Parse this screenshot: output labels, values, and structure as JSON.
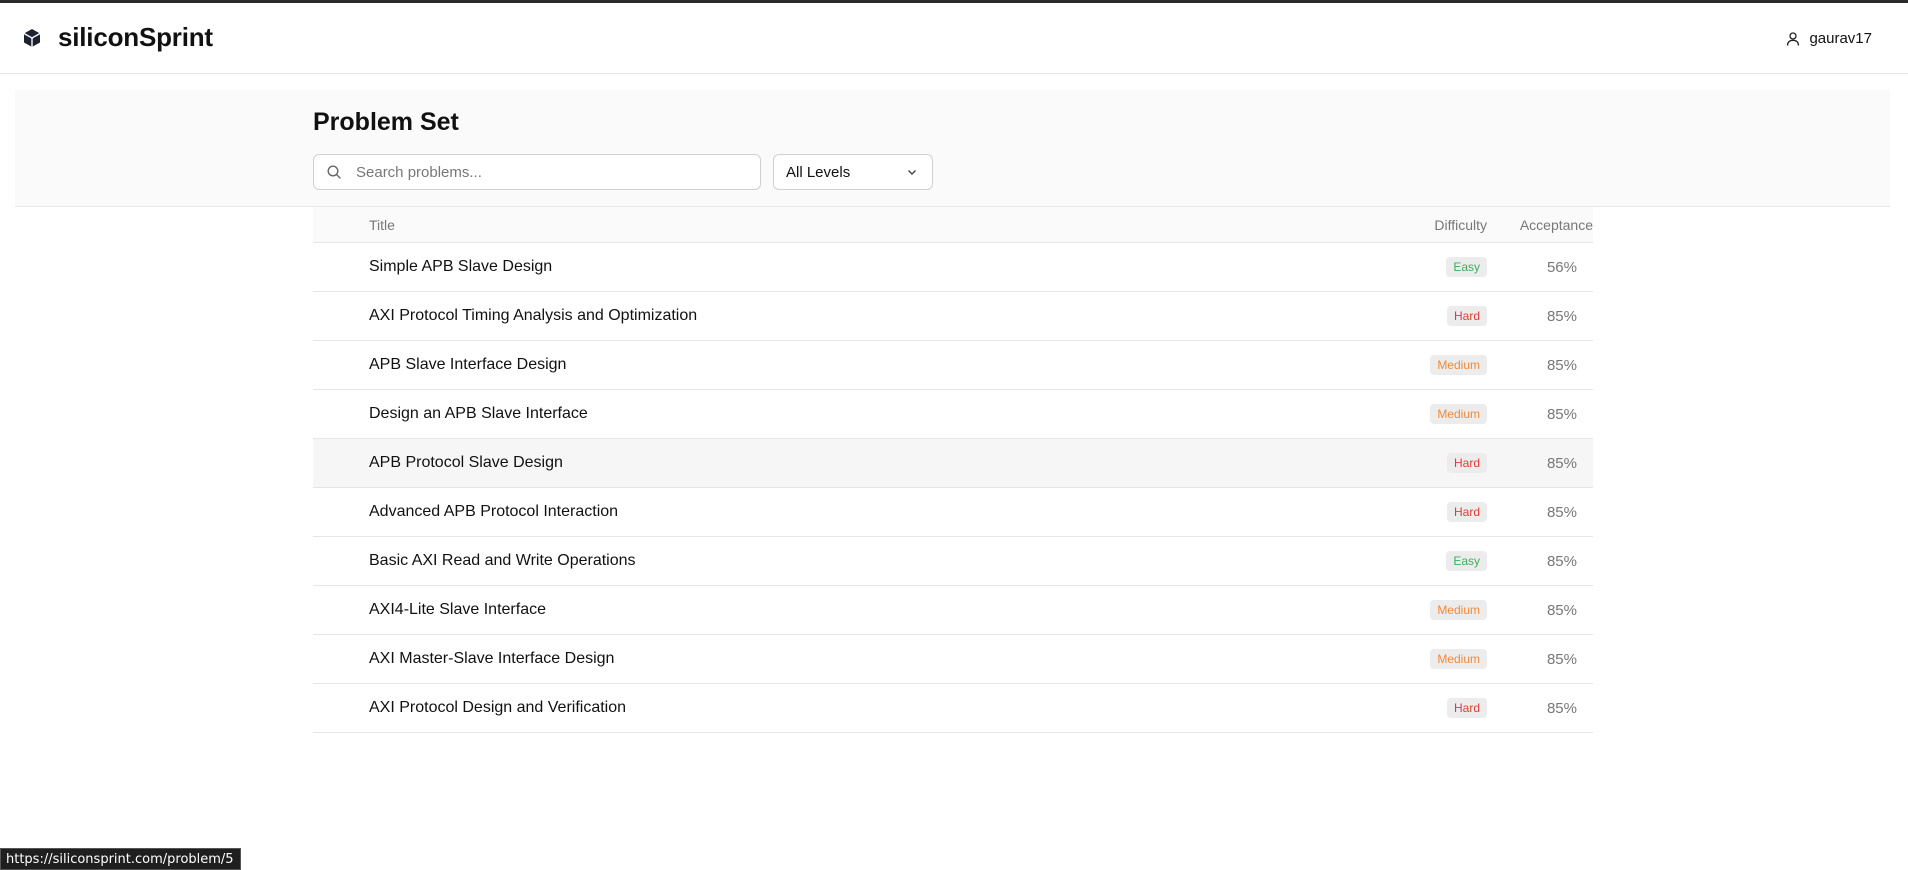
{
  "app": {
    "brand_name": "siliconSprint"
  },
  "header": {
    "username": "gaurav17"
  },
  "main": {
    "title": "Problem Set",
    "search": {
      "placeholder": "Search problems...",
      "value": ""
    },
    "level_filter": {
      "selected": "All Levels"
    },
    "table": {
      "columns": {
        "title": "Title",
        "difficulty": "Difficulty",
        "acceptance": "Acceptance"
      },
      "rows": [
        {
          "title": "Simple APB Slave Design",
          "difficulty": "Easy",
          "acceptance": "56%"
        },
        {
          "title": "AXI Protocol Timing Analysis and Optimization",
          "difficulty": "Hard",
          "acceptance": "85%"
        },
        {
          "title": "APB Slave Interface Design",
          "difficulty": "Medium",
          "acceptance": "85%"
        },
        {
          "title": "Design an APB Slave Interface",
          "difficulty": "Medium",
          "acceptance": "85%"
        },
        {
          "title": "APB Protocol Slave Design",
          "difficulty": "Hard",
          "acceptance": "85%"
        },
        {
          "title": "Advanced APB Protocol Interaction",
          "difficulty": "Hard",
          "acceptance": "85%"
        },
        {
          "title": "Basic AXI Read and Write Operations",
          "difficulty": "Easy",
          "acceptance": "85%"
        },
        {
          "title": "AXI4-Lite Slave Interface",
          "difficulty": "Medium",
          "acceptance": "85%"
        },
        {
          "title": "AXI Master-Slave Interface Design",
          "difficulty": "Medium",
          "acceptance": "85%"
        },
        {
          "title": "AXI Protocol Design and Verification",
          "difficulty": "Hard",
          "acceptance": "85%"
        }
      ]
    }
  },
  "status_bar": {
    "url": "https://siliconsprint.com/problem/5"
  },
  "colors": {
    "easy": "#3cae5c",
    "medium": "#ef8a3a",
    "hard": "#e03b3b",
    "badge_bg": "#ececec"
  },
  "icons": {
    "logo": "hexagon-logo-icon",
    "user": "user-icon",
    "search": "search-icon",
    "chevron": "chevron-down-icon"
  }
}
